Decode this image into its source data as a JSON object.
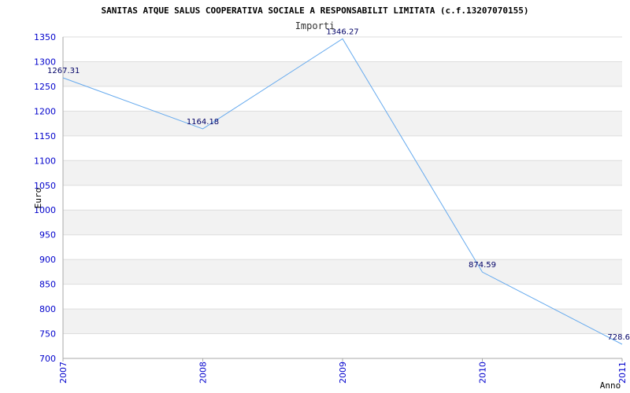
{
  "chart_data": {
    "type": "line",
    "title": "SANITAS ATQUE SALUS COOPERATIVA SOCIALE A RESPONSABILIT LIMITATA (c.f.13207070155)",
    "subtitle": "Importi",
    "xlabel": "Anno",
    "ylabel": "Euro",
    "categories": [
      "2007",
      "2008",
      "2009",
      "2010",
      "2011"
    ],
    "series": [
      {
        "values": [
          1267.31,
          1164.18,
          1346.27,
          874.59,
          728.6
        ]
      }
    ],
    "data_labels": [
      "1267.31",
      "1164.18",
      "1346.27",
      "874.59",
      "728.6"
    ],
    "ylim": [
      700,
      1350
    ],
    "yticks": [
      "700",
      "750",
      "800",
      "850",
      "900",
      "950",
      "1000",
      "1050",
      "1100",
      "1150",
      "1200",
      "1250",
      "1300",
      "1350"
    ],
    "grid": true,
    "colors": {
      "line": "#66aaee",
      "band": "#f2f2f2",
      "grid": "#dddddd",
      "tick": "#0000cc",
      "label": "#000066"
    }
  }
}
